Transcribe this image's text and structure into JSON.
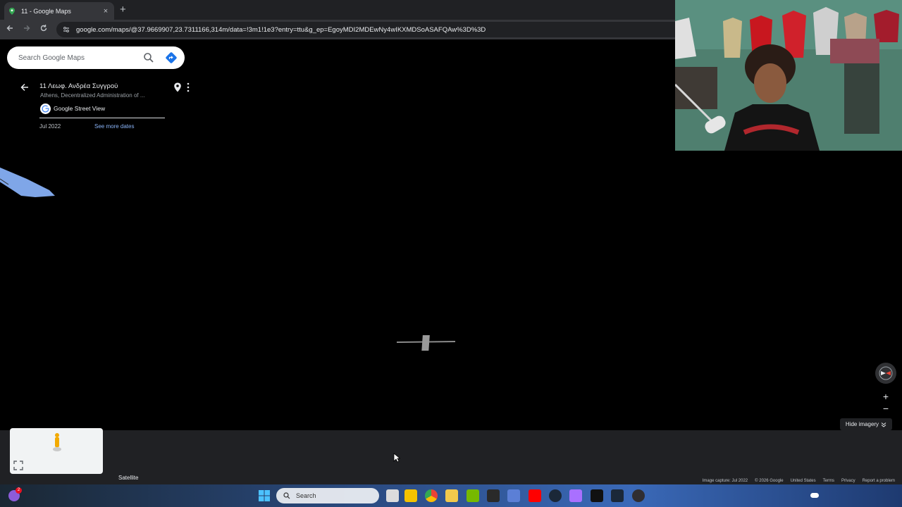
{
  "browser": {
    "tab_title": "11 - Google Maps",
    "new_tab": "+",
    "close": "×",
    "url": "google.com/maps/@37.9669907,23.7311166,314m/data=!3m1!1e3?entry=ttu&g_ep=EgoyMDI2MDEwNy4wIKXMDSoASAFQAw%3D%3D"
  },
  "maps": {
    "search_placeholder": "Search Google Maps",
    "place": {
      "title": "11 Λεωφ. Ανδρέα Συγγρού",
      "subtitle": "Athens, Decentralized Administration of ...",
      "provider": "Google Street View",
      "date": "Jul 2022",
      "more_dates": "See more dates"
    },
    "controls": {
      "zoom_in": "+",
      "zoom_out": "−",
      "hide_imagery": "Hide imagery"
    },
    "layer_label": "Satellite",
    "footer": [
      "Image capture: Jul 2022",
      "© 2026 Google",
      "United States",
      "Terms",
      "Privacy",
      "Report a problem"
    ]
  },
  "taskbar": {
    "search_label": "Search",
    "notification_count": "2"
  },
  "colors": {
    "accent_blue": "#8ab4f8",
    "road_blue": "#7fa6e8"
  }
}
